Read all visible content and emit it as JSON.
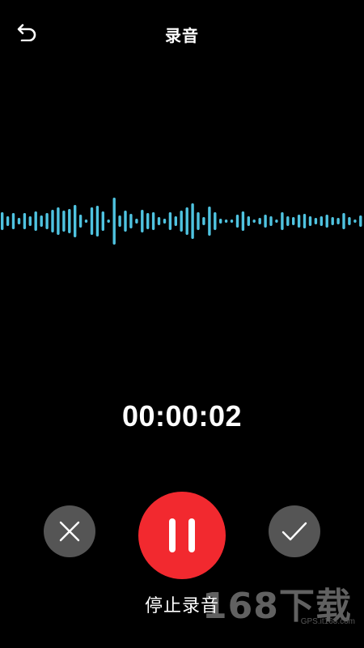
{
  "header": {
    "title": "录音",
    "back_icon": "back-arrow-icon"
  },
  "waveform": {
    "color": "#4fc3e0",
    "levels": [
      0.22,
      0.12,
      0.2,
      0.08,
      0.2,
      0.12,
      0.24,
      0.14,
      0.2,
      0.28,
      0.34,
      0.26,
      0.3,
      0.4,
      0.16,
      0.04,
      0.34,
      0.38,
      0.24,
      0.04,
      0.58,
      0.14,
      0.26,
      0.18,
      0.06,
      0.28,
      0.2,
      0.22,
      0.1,
      0.06,
      0.22,
      0.12,
      0.26,
      0.34,
      0.44,
      0.22,
      0.1,
      0.36,
      0.22,
      0.06,
      0.04,
      0.04,
      0.16,
      0.24,
      0.12,
      0.04,
      0.08,
      0.16,
      0.12,
      0.04,
      0.22,
      0.12,
      0.1,
      0.16,
      0.18,
      0.12,
      0.08,
      0.12,
      0.16,
      0.1,
      0.08,
      0.2,
      0.1,
      0.04,
      0.14
    ]
  },
  "timer": {
    "elapsed": "00:00:02"
  },
  "controls": {
    "cancel_icon": "close-icon",
    "pause_icon": "pause-icon",
    "confirm_icon": "check-icon",
    "pause_label": "停止录音",
    "cancel_color": "#555555",
    "pause_color": "#f2292f",
    "confirm_color": "#555555"
  },
  "watermark": {
    "text": "168下载",
    "url": "GPS.it168.com"
  }
}
